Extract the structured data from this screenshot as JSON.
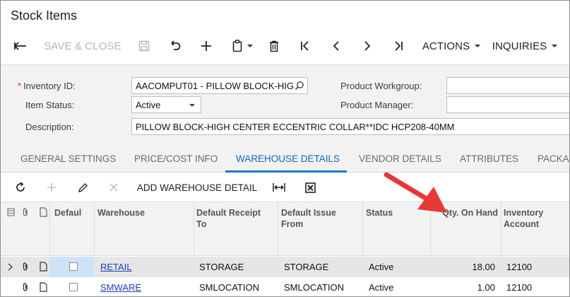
{
  "app": {
    "title": "Stock Items"
  },
  "toolbar": {
    "save_close_label": "SAVE & CLOSE",
    "actions_label": "ACTIONS",
    "inquiries_label": "INQUIRIES"
  },
  "form": {
    "inventory_id_label": "Inventory ID:",
    "inventory_id_value": "AACOMPUT01 - PILLOW BLOCK-HIG",
    "item_status_label": "Item Status:",
    "item_status_value": "Active",
    "description_label": "Description:",
    "description_value": "PILLOW BLOCK-HIGH CENTER ECCENTRIC COLLAR**IDC HCP208-40MM",
    "product_workgroup_label": "Product Workgroup:",
    "product_manager_label": "Product Manager:"
  },
  "tabs": [
    {
      "label": "GENERAL SETTINGS"
    },
    {
      "label": "PRICE/COST INFO"
    },
    {
      "label": "WAREHOUSE DETAILS"
    },
    {
      "label": "VENDOR DETAILS"
    },
    {
      "label": "ATTRIBUTES"
    },
    {
      "label": "PACKAG"
    }
  ],
  "grid_toolbar": {
    "add_warehouse_detail_label": "ADD WAREHOUSE DETAIL"
  },
  "grid": {
    "columns": {
      "default": "Defaul",
      "warehouse": "Warehouse",
      "receipt_1": "Default Receipt",
      "receipt_2": "To",
      "issue_1": "Default Issue",
      "issue_2": "From",
      "status": "Status",
      "qty": "Qty. On Hand",
      "inv_1": "Inventory",
      "inv_2": "Account"
    },
    "rows": [
      {
        "warehouse": "RETAIL",
        "receipt": "STORAGE",
        "issue": "STORAGE",
        "status": "Active",
        "qty": "18.00",
        "account": "12100"
      },
      {
        "warehouse": "SMWARE",
        "receipt": "SMLOCATION",
        "issue": "SMLOCATION",
        "status": "Active",
        "qty": "1.00",
        "account": "12100"
      }
    ]
  },
  "colors": {
    "accent": "#1976d2",
    "arrow": "#e53935",
    "link": "#1a3fb5"
  }
}
